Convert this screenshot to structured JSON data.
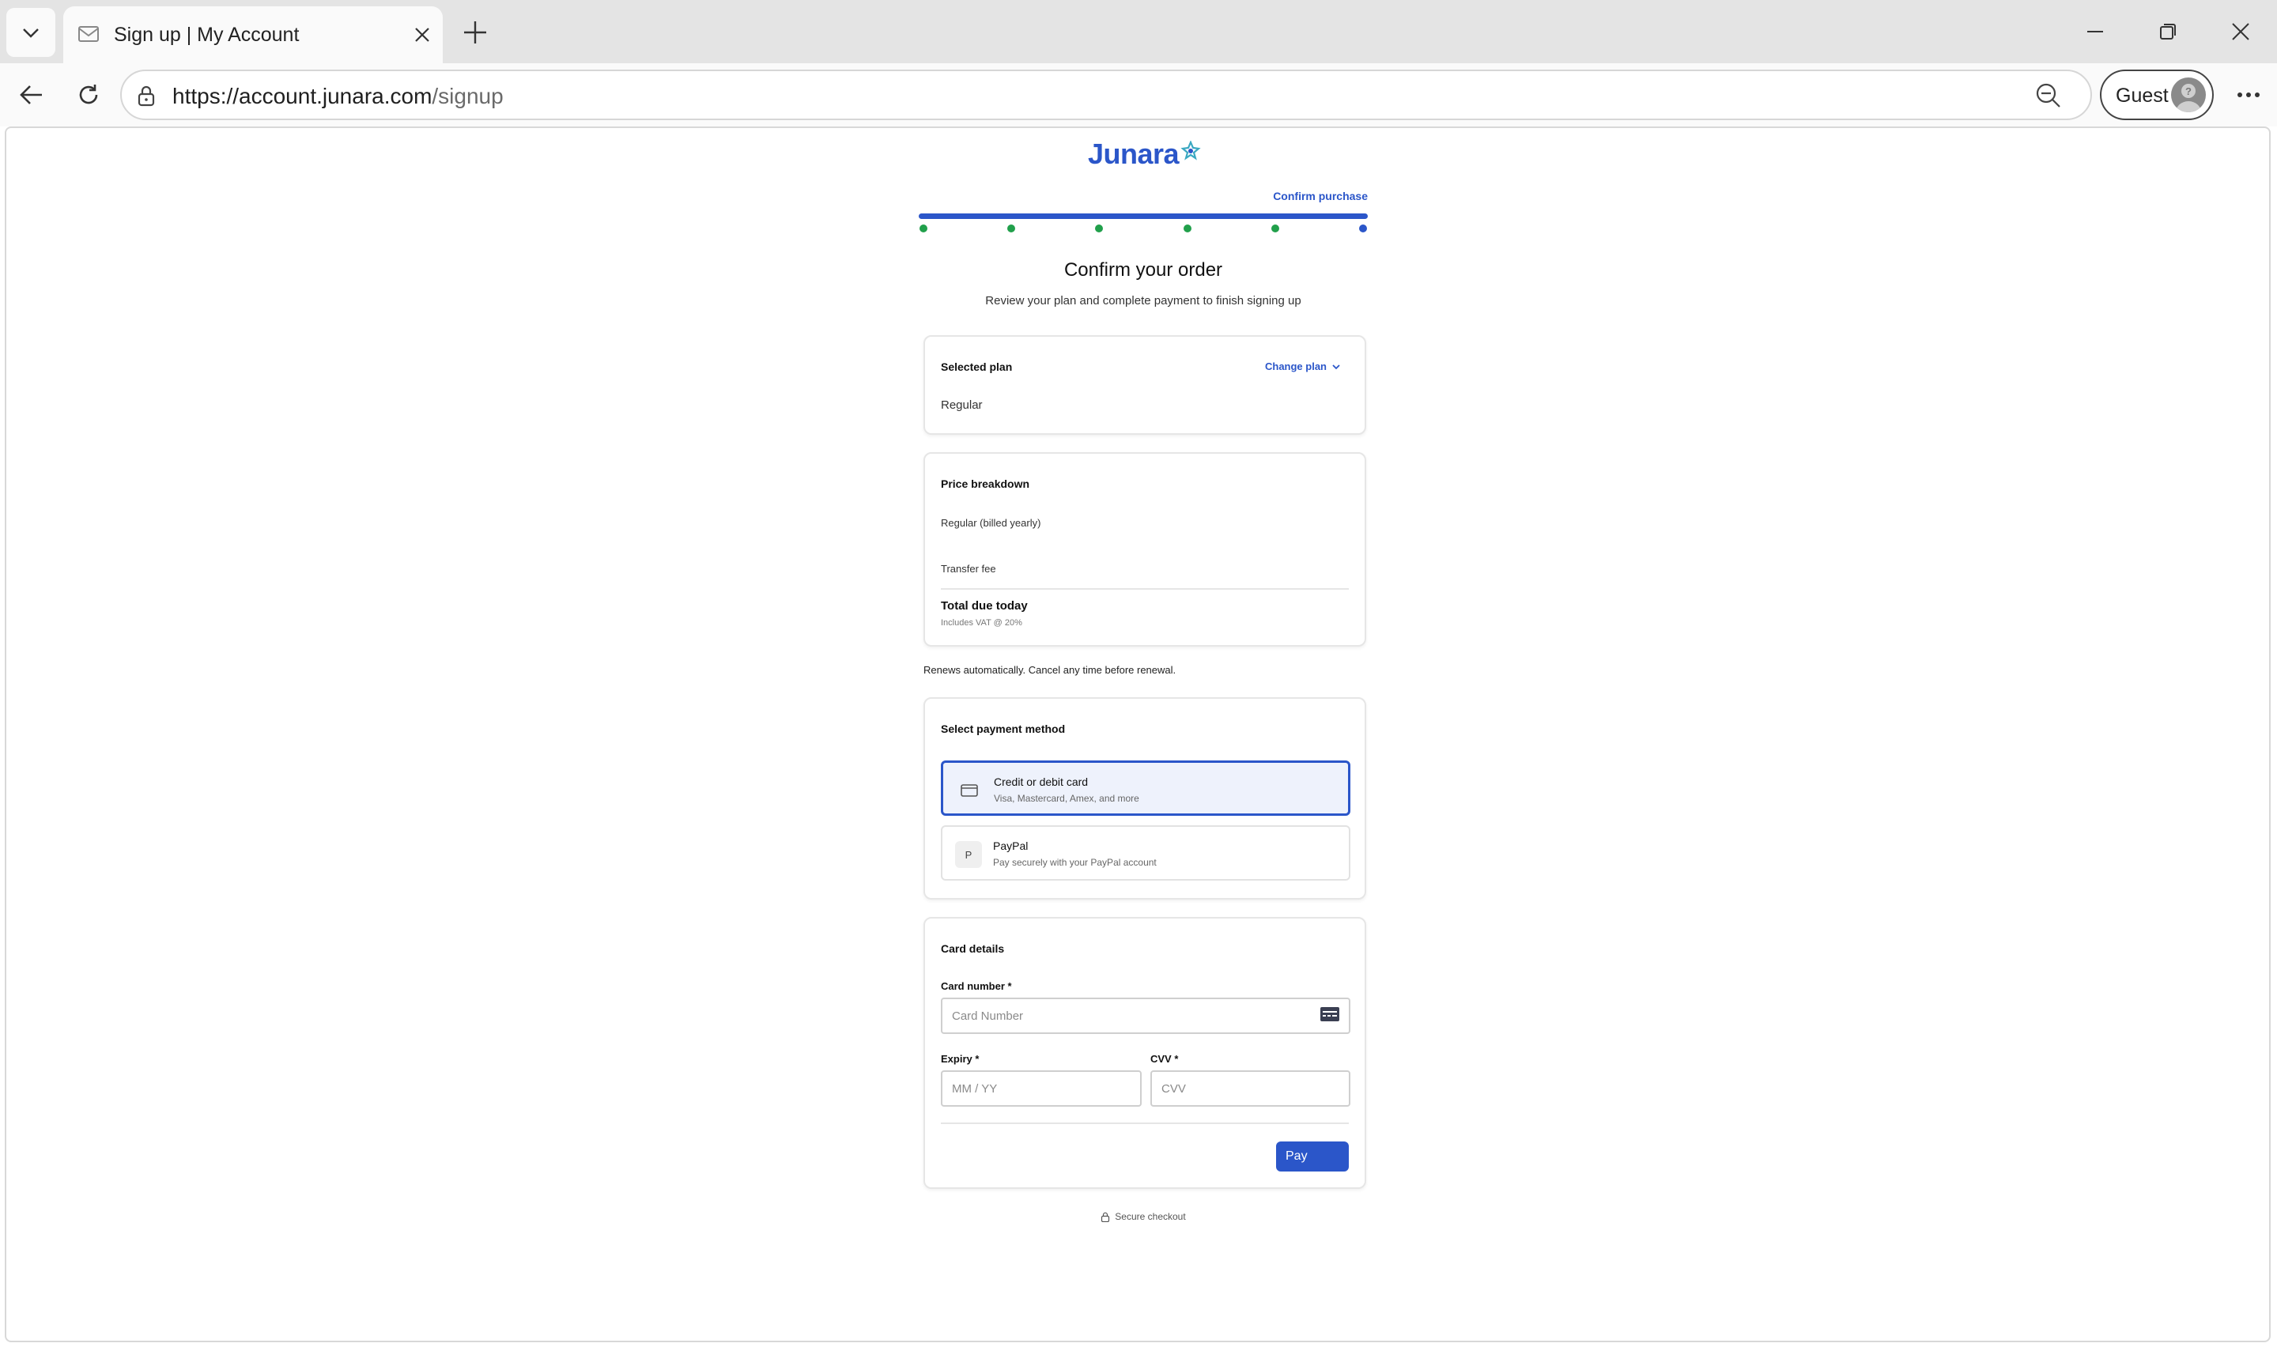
{
  "browser": {
    "tab_title": "Sign up | My Account",
    "url_host": "https://account.junara.com",
    "url_path": "/signup",
    "profile_label": "Guest"
  },
  "page": {
    "brand": "Junara",
    "brand_color": "#2b56c9",
    "step_label": "Confirm purchase",
    "progress": {
      "total_steps": 6,
      "completed_steps": 5,
      "current_step": 6,
      "completed_color": "#21a04b",
      "current_color": "#2b56c9"
    },
    "heading": "Confirm your order",
    "subheading": "Review your plan and complete payment to finish signing up",
    "selected_plan": {
      "title": "Selected plan",
      "change_label": "Change plan",
      "plan_name": "Regular"
    },
    "price_breakdown": {
      "title": "Price breakdown",
      "line1": "Regular (billed yearly)",
      "line2": "Transfer fee",
      "total_label": "Total due today",
      "vat_note": "Includes VAT @ 20%"
    },
    "renew_note": "Renews automatically. Cancel any time before renewal.",
    "payment": {
      "title": "Select payment method",
      "options": [
        {
          "title": "Credit or debit card",
          "subtitle": "Visa, Mastercard, Amex, and more",
          "icon": "credit-card-icon",
          "selected": true
        },
        {
          "title": "PayPal",
          "subtitle": "Pay securely with your PayPal account",
          "icon_letter": "P",
          "selected": false
        }
      ]
    },
    "card_details": {
      "title": "Card details",
      "card_number_label": "Card number *",
      "card_number_placeholder": "Card Number",
      "expiry_label": "Expiry *",
      "expiry_placeholder": "MM / YY",
      "cvv_label": "CVV *",
      "cvv_placeholder": "CVV",
      "pay_label": "Pay"
    },
    "secure_note": "Secure checkout"
  }
}
